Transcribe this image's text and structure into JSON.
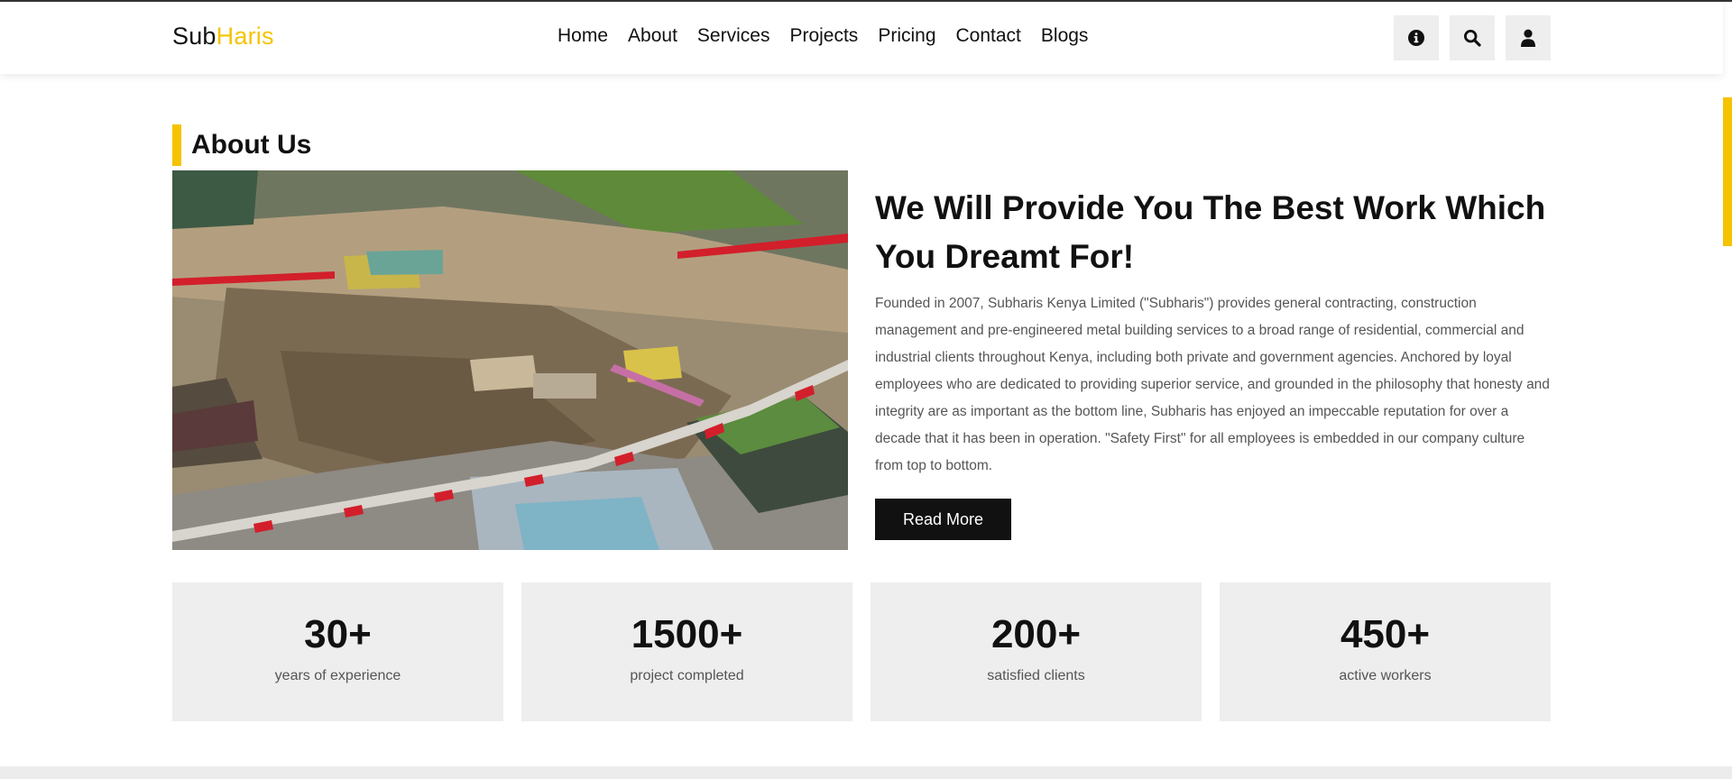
{
  "brand": {
    "part1": "Sub",
    "part2": "Haris"
  },
  "nav": {
    "items": [
      {
        "label": "Home"
      },
      {
        "label": "About"
      },
      {
        "label": "Services"
      },
      {
        "label": "Projects"
      },
      {
        "label": "Pricing"
      },
      {
        "label": "Contact"
      },
      {
        "label": "Blogs"
      }
    ]
  },
  "header_icons": [
    "info-icon",
    "search-icon",
    "user-icon"
  ],
  "section": {
    "title": "About Us"
  },
  "about": {
    "headline": "We Will Provide You The Best Work Which You Dreamt For!",
    "description": "Founded in 2007, Subharis Kenya Limited (\"Subharis\") provides general contracting, construction management and pre-engineered metal building services to a broad range of residential, commercial and industrial clients throughout Kenya, including both private and government agencies. Anchored by loyal employees who are dedicated to providing superior service, and grounded in the philosophy that honesty and integrity are as important as the bottom line, Subharis has enjoyed an impeccable reputation for over a decade that it has been in operation. \"Safety First\" for all employees is embedded in our company culture from top to bottom.",
    "button": "Read More"
  },
  "stats": [
    {
      "value": "30+",
      "label": "years of experience"
    },
    {
      "value": "1500+",
      "label": "project completed"
    },
    {
      "value": "200+",
      "label": "satisfied clients"
    },
    {
      "value": "450+",
      "label": "active workers"
    }
  ],
  "colors": {
    "accent": "#f5c300",
    "dark": "#111111",
    "panel": "#eeeeee",
    "text_muted": "#555555"
  }
}
